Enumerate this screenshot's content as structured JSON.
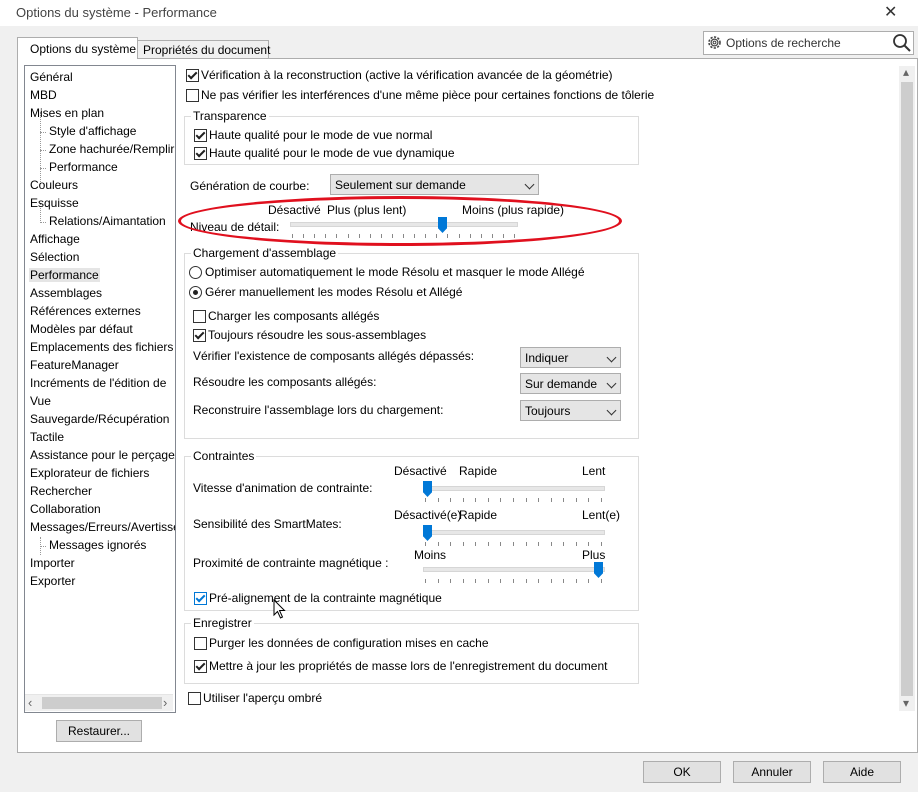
{
  "window": {
    "title": "Options du système - Performance",
    "close": "✕"
  },
  "tabs": [
    "Options du système",
    "Propriétés du document"
  ],
  "search": {
    "label": "Options de recherche",
    "gear_icon": "gear-icon",
    "search_icon": "search-icon"
  },
  "tree": [
    {
      "label": "Général",
      "level": 0
    },
    {
      "label": "MBD",
      "level": 0
    },
    {
      "label": "Mises en plan",
      "level": 0
    },
    {
      "label": "Style d'affichage",
      "level": 1
    },
    {
      "label": "Zone hachurée/Remplir",
      "level": 1
    },
    {
      "label": "Performance",
      "level": 1
    },
    {
      "label": "Couleurs",
      "level": 0
    },
    {
      "label": "Esquisse",
      "level": 0
    },
    {
      "label": "Relations/Aimantation",
      "level": 1
    },
    {
      "label": "Affichage",
      "level": 0
    },
    {
      "label": "Sélection",
      "level": 0
    },
    {
      "label": "Performance",
      "level": 0,
      "selected": true
    },
    {
      "label": "Assemblages",
      "level": 0
    },
    {
      "label": "Références externes",
      "level": 0
    },
    {
      "label": "Modèles par défaut",
      "level": 0
    },
    {
      "label": "Emplacements des fichiers",
      "level": 0
    },
    {
      "label": "FeatureManager",
      "level": 0
    },
    {
      "label": "Incréments de l'édition de",
      "level": 0
    },
    {
      "label": "Vue",
      "level": 0
    },
    {
      "label": "Sauvegarde/Récupération",
      "level": 0
    },
    {
      "label": "Tactile",
      "level": 0
    },
    {
      "label": "Assistance pour le perçage/",
      "level": 0
    },
    {
      "label": "Explorateur de fichiers",
      "level": 0
    },
    {
      "label": "Rechercher",
      "level": 0
    },
    {
      "label": "Collaboration",
      "level": 0
    },
    {
      "label": "Messages/Erreurs/Avertisse",
      "level": 0
    },
    {
      "label": "Messages ignorés",
      "level": 1
    },
    {
      "label": "Importer",
      "level": 0
    },
    {
      "label": "Exporter",
      "level": 0
    }
  ],
  "scroll": {
    "left_arrow": "‹",
    "right_arrow": "›",
    "up_arrow": "▴",
    "down_arrow": "▾"
  },
  "options": {
    "verif_reconstruction": {
      "label": "Vérification à la reconstruction (active la vérification avancée de la géométrie)",
      "checked": true
    },
    "no_interference": {
      "label": "Ne pas vérifier les interférences d'une même pièce pour certaines fonctions de tôlerie",
      "checked": false
    }
  },
  "transparence": {
    "title": "Transparence",
    "hq_normal": {
      "label": "Haute qualité pour le mode de vue normal",
      "checked": true
    },
    "hq_dynamic": {
      "label": "Haute qualité pour le mode de vue dynamique",
      "checked": true
    }
  },
  "courbe": {
    "label": "Génération de courbe:",
    "value": "Seulement sur demande"
  },
  "detail": {
    "label": "Niveau de détail:",
    "left": "Désactivé",
    "mid": "Plus (plus lent)",
    "right": "Moins (plus rapide)",
    "level": 0.68
  },
  "assemblage": {
    "title": "Chargement d'assemblage",
    "radio_auto": {
      "label": "Optimiser automatiquement le mode Résolu et masquer le mode Allégé",
      "selected": false
    },
    "radio_manual": {
      "label": "Gérer manuellement les modes Résolu et Allégé",
      "selected": true
    },
    "charger_alleges": {
      "label": "Charger les composants allégés",
      "checked": false
    },
    "resoudre_sous": {
      "label": "Toujours résoudre les sous-assemblages",
      "checked": true
    },
    "verif_label": "Vérifier l'existence de composants allégés dépassés:",
    "verif_value": "Indiquer",
    "resoudre_label": "Résoudre les composants allégés:",
    "resoudre_value": "Sur demande",
    "reconstruire_label": "Reconstruire l'assemblage lors du chargement:",
    "reconstruire_value": "Toujours"
  },
  "contraintes": {
    "title": "Contraintes",
    "vitesse": {
      "label": "Vitesse d'animation de contrainte:",
      "l1": "Désactivé",
      "l2": "Rapide",
      "l3": "Lent",
      "level": 0.0
    },
    "smartmates": {
      "label": "Sensibilité des SmartMates:",
      "l1": "Désactivé(e)",
      "l2": "Rapide",
      "l3": "Lent(e)",
      "level": 0.0
    },
    "proximite": {
      "label": "Proximité de contrainte magnétique :",
      "l1": "Moins",
      "l3": "Plus",
      "level": 1.0
    },
    "prealignement": {
      "label": "Pré-alignement de la contrainte magnétique",
      "checked": true
    }
  },
  "enregistrer": {
    "title": "Enregistrer",
    "purger": {
      "label": "Purger les données de configuration mises en cache",
      "checked": false
    },
    "maj": {
      "label": "Mettre à jour les propriétés de masse lors de l'enregistrement du document",
      "checked": true
    }
  },
  "apercu": {
    "label": "Utiliser l'aperçu ombré",
    "checked": false
  },
  "buttons": {
    "restore": "Restaurer...",
    "ok": "OK",
    "cancel": "Annuler",
    "help": "Aide"
  },
  "colors": {
    "accent": "#0078d7",
    "highlight": "#e0101e"
  }
}
